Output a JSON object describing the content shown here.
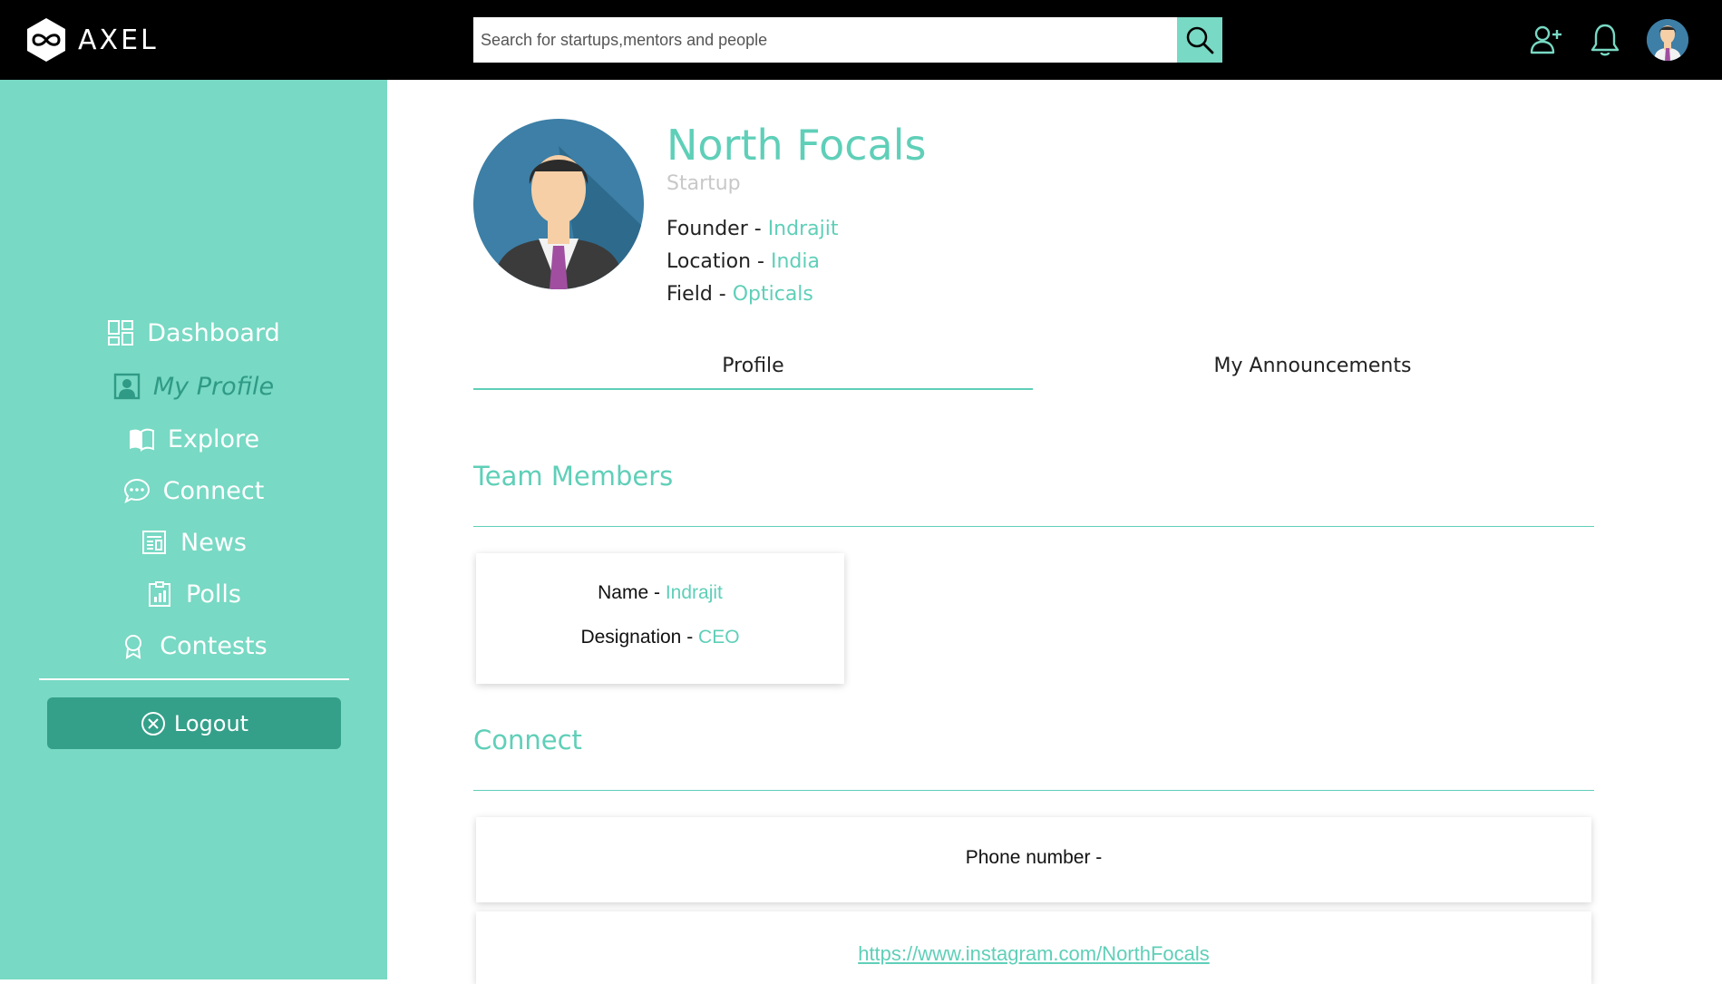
{
  "app": {
    "name": "AXEL"
  },
  "search": {
    "placeholder": "Search for startups,mentors and people"
  },
  "sidebar": {
    "items": [
      {
        "label": "Dashboard",
        "icon": "dashboard-icon"
      },
      {
        "label": "My Profile",
        "icon": "profile-icon",
        "active": true
      },
      {
        "label": "Explore",
        "icon": "book-icon"
      },
      {
        "label": "Connect",
        "icon": "chat-icon"
      },
      {
        "label": "News",
        "icon": "newspaper-icon"
      },
      {
        "label": "Polls",
        "icon": "poll-icon"
      },
      {
        "label": "Contests",
        "icon": "award-icon"
      }
    ],
    "logout_label": "Logout"
  },
  "profile": {
    "name": "North Focals",
    "type": "Startup",
    "founder_label": "Founder - ",
    "founder": "Indrajit",
    "location_label": "Location - ",
    "location": "India",
    "field_label": "Field - ",
    "field": "Opticals"
  },
  "tabs": [
    {
      "label": "Profile",
      "active": true
    },
    {
      "label": "My Announcements",
      "active": false
    }
  ],
  "team": {
    "title": "Team Members",
    "members": [
      {
        "name_label": "Name - ",
        "name": "Indrajit",
        "designation_label": "Designation - ",
        "designation": "CEO"
      }
    ]
  },
  "connect": {
    "title": "Connect",
    "phone_label": "Phone number -",
    "instagram": "https://www.instagram.com/NorthFocals"
  },
  "colors": {
    "accent": "#78d9c4",
    "accent_dark": "#34a08a",
    "text_accent": "#5fcfb8",
    "topbar": "#000000"
  }
}
